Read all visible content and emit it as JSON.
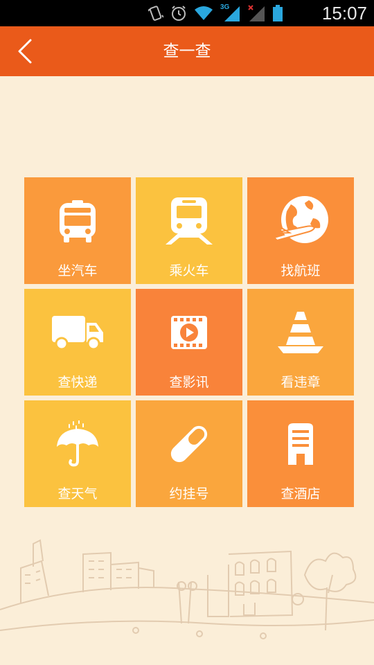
{
  "status_bar": {
    "network_label": "3G",
    "time": "15:07",
    "icons": [
      "vibrate-icon",
      "alarm-icon",
      "wifi-icon",
      "signal-3g-icon",
      "signal-no-sim-icon",
      "battery-icon"
    ]
  },
  "header": {
    "title": "查一查",
    "back_icon": "chevron-left-icon",
    "background": "#ea5a1a"
  },
  "tiles": [
    {
      "label": "坐汽车",
      "icon": "bus-icon",
      "color": "#fa9a3c"
    },
    {
      "label": "乘火车",
      "icon": "train-icon",
      "color": "#fbc23f"
    },
    {
      "label": "找航班",
      "icon": "globe-plane-icon",
      "color": "#fa8f3a"
    },
    {
      "label": "查快递",
      "icon": "truck-icon",
      "color": "#fbc23f"
    },
    {
      "label": "查影讯",
      "icon": "film-icon",
      "color": "#f9833a"
    },
    {
      "label": "看违章",
      "icon": "traffic-cone-icon",
      "color": "#faa63d"
    },
    {
      "label": "查天气",
      "icon": "umbrella-icon",
      "color": "#fbc23f"
    },
    {
      "label": "约挂号",
      "icon": "pill-icon",
      "color": "#faa63d"
    },
    {
      "label": "查酒店",
      "icon": "hotel-building-icon",
      "color": "#fa8f3a"
    }
  ],
  "colors": {
    "background": "#fbeed8",
    "footer_sketch": "#e2cbb0"
  }
}
